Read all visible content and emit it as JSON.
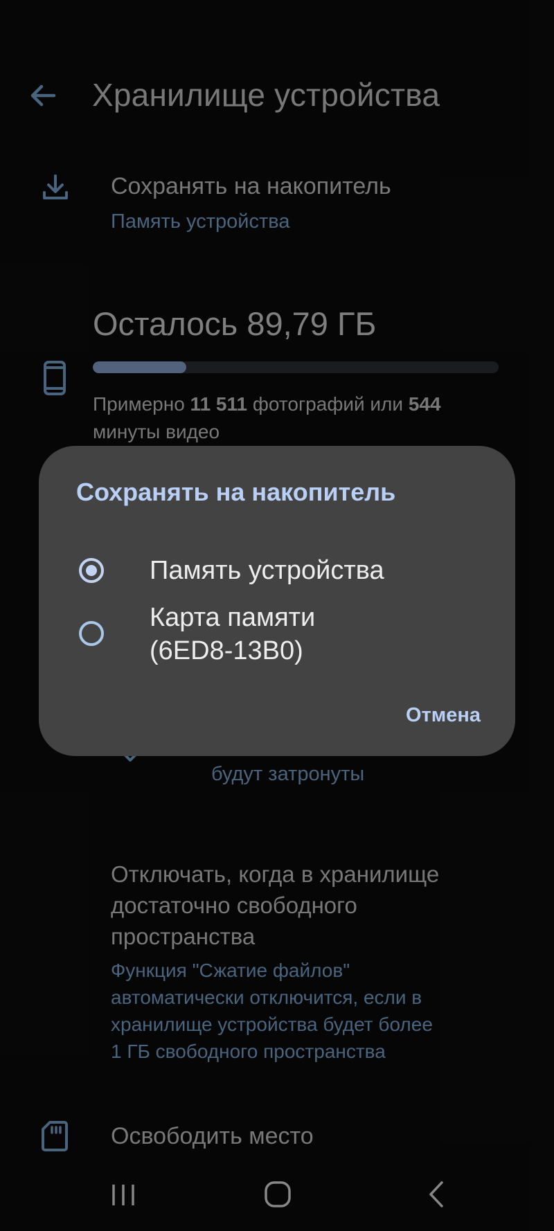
{
  "header": {
    "title": "Хранилище устройства",
    "back_icon": "arrow-back-icon"
  },
  "save_to": {
    "icon": "download-icon",
    "title": "Сохранять на накопитель",
    "value": "Память устройства"
  },
  "storage": {
    "icon": "phone-icon",
    "remaining": "Осталось 89,79 ГБ",
    "used_fraction": 0.23,
    "desc_prefix": "Примерно ",
    "photos_count": "11 511",
    "desc_middle": " фотографий или ",
    "video_minutes": "544",
    "desc_suffix": "минуты видео"
  },
  "compress": {
    "icon": "check-shield-icon",
    "partial_text": "будут затронуты"
  },
  "disable_when": {
    "title_line1": "Отключать, когда в хранилище",
    "title_line2": "достаточно свободного",
    "title_line3": "пространства",
    "desc_line1": "Функция \"Сжатие файлов\"",
    "desc_line2": "автоматически отключится, если в",
    "desc_line3": "хранилище устройства будет более",
    "desc_line4": "1 ГБ свободного пространства"
  },
  "free_up": {
    "icon": "sd-card-icon",
    "title": "Освободить место"
  },
  "dialog": {
    "title": "Сохранять на накопитель",
    "options": [
      {
        "label": "Память устройства",
        "selected": true
      },
      {
        "label_line1": "Карта памяти",
        "label_line2": "(6ED8-13B0)",
        "selected": false
      }
    ],
    "cancel_label": "Отмена"
  },
  "navbar": {
    "recents_icon": "recents-icon",
    "home_icon": "home-icon",
    "back_icon": "nav-back-icon"
  },
  "colors": {
    "background": "#0a0a0a",
    "accent_text": "#6f9ac2",
    "dialog_bg": "#434343",
    "dialog_accent": "#b9cff5"
  }
}
